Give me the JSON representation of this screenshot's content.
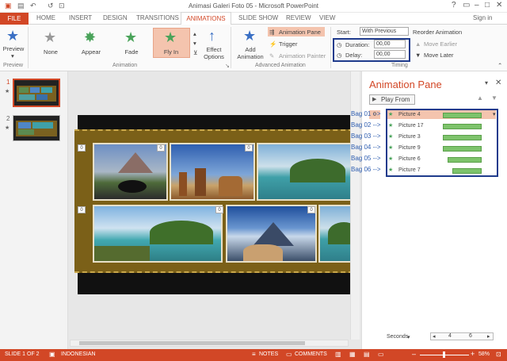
{
  "window": {
    "title": "Animasi Galeri Foto 05 - Microsoft PowerPoint",
    "user": "Sign in"
  },
  "tabs": [
    "FILE",
    "HOME",
    "INSERT",
    "DESIGN",
    "TRANSITIONS",
    "ANIMATIONS",
    "SLIDE SHOW",
    "REVIEW",
    "VIEW"
  ],
  "ribbon": {
    "preview": {
      "button": "Preview",
      "group": "Preview"
    },
    "effects": [
      "None",
      "Appear",
      "Fade",
      "Fly In"
    ],
    "effect_options": "Effect Options",
    "animation_group": "Animation",
    "add_animation": "Add Animation",
    "animation_pane": "Animation Pane",
    "trigger": "Trigger",
    "animation_painter": "Animation Painter",
    "advanced_group": "Advanced Animation",
    "start_label": "Start:",
    "start_value": "With Previous",
    "duration_label": "Duration:",
    "duration_value": "00,00",
    "delay_label": "Delay:",
    "delay_value": "00,00",
    "reorder": "Reorder Animation",
    "move_earlier": "Move Earlier",
    "move_later": "Move Later",
    "timing_group": "Timing"
  },
  "thumbnails": [
    {
      "number": "1"
    },
    {
      "number": "2"
    }
  ],
  "slide": {
    "badge": "0"
  },
  "pane": {
    "title": "Animation Pane",
    "play_from": "Play From",
    "first_index": "0",
    "items": [
      {
        "label": "Picture 4",
        "bag": "Bag 01 -->",
        "start": 0.35,
        "end": 0.95
      },
      {
        "label": "Picture 17",
        "bag": "Bag 02 -->",
        "start": 0.35,
        "end": 0.95
      },
      {
        "label": "Picture 3",
        "bag": "Bag 03 -->",
        "start": 0.35,
        "end": 0.95
      },
      {
        "label": "Picture 9",
        "bag": "Bag 04 -->",
        "start": 0.35,
        "end": 0.95
      },
      {
        "label": "Picture 6",
        "bag": "Bag 05 -->",
        "start": 0.45,
        "end": 0.95
      },
      {
        "label": "Picture 7",
        "bag": "Bag 06 -->",
        "start": 0.55,
        "end": 0.95
      }
    ],
    "seconds": "Seconds",
    "timeline_start": "4",
    "timeline_end": "6"
  },
  "status": {
    "slide": "SLIDE 1 OF 2",
    "language": "INDONESIAN",
    "notes": "NOTES",
    "comments": "COMMENTS",
    "zoom": "58%"
  }
}
